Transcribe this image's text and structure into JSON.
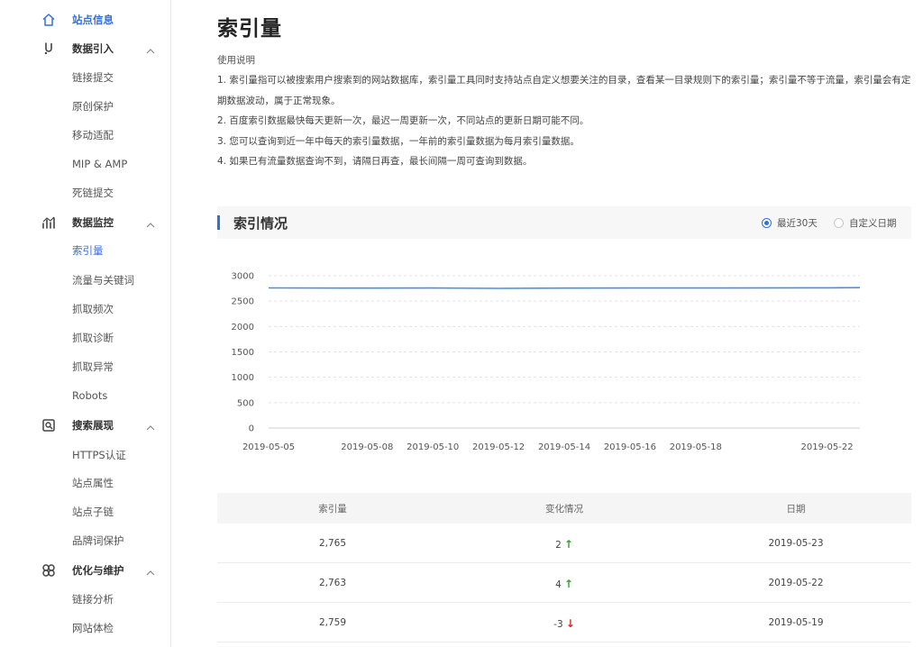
{
  "sidebar": {
    "items": [
      {
        "label": "站点信息",
        "type": "group",
        "icon": "home-icon",
        "active": true
      },
      {
        "label": "数据引入",
        "type": "group",
        "icon": "data-import-icon",
        "expanded": true
      },
      {
        "label": "链接提交",
        "type": "sub"
      },
      {
        "label": "原创保护",
        "type": "sub"
      },
      {
        "label": "移动适配",
        "type": "sub"
      },
      {
        "label": "MIP & AMP",
        "type": "sub"
      },
      {
        "label": "死链提交",
        "type": "sub"
      },
      {
        "label": "数据监控",
        "type": "group",
        "icon": "data-monitor-icon",
        "expanded": true
      },
      {
        "label": "索引量",
        "type": "sub",
        "active": true
      },
      {
        "label": "流量与关键词",
        "type": "sub"
      },
      {
        "label": "抓取频次",
        "type": "sub"
      },
      {
        "label": "抓取诊断",
        "type": "sub"
      },
      {
        "label": "抓取异常",
        "type": "sub"
      },
      {
        "label": "Robots",
        "type": "sub"
      },
      {
        "label": "搜索展现",
        "type": "group",
        "icon": "search-display-icon",
        "expanded": true
      },
      {
        "label": "HTTPS认证",
        "type": "sub"
      },
      {
        "label": "站点属性",
        "type": "sub"
      },
      {
        "label": "站点子链",
        "type": "sub"
      },
      {
        "label": "品牌词保护",
        "type": "sub"
      },
      {
        "label": "优化与维护",
        "type": "group",
        "icon": "optimize-icon",
        "expanded": true
      },
      {
        "label": "链接分析",
        "type": "sub"
      },
      {
        "label": "网站体检",
        "type": "sub"
      }
    ]
  },
  "main": {
    "title": "索引量",
    "usage_title": "使用说明",
    "usage_lines": [
      "1. 索引量指可以被搜索用户搜索到的网站数据库，索引量工具同时支持站点自定义想要关注的目录，查看某一目录规则下的索引量；索引量不等于流量，索引量会有定期数据波动，属于正常现象。",
      "2. 百度索引数据最快每天更新一次，最迟一周更新一次，不同站点的更新日期可能不同。",
      "3. 您可以查询到近一年中每天的索引量数据，一年前的索引量数据为每月索引量数据。",
      "4. 如果已有流量数据查询不到，请隔日再查，最长间隔一周可查询到数据。"
    ],
    "section_title": "索引情况",
    "radio_options": [
      {
        "label": "最近30天",
        "checked": true
      },
      {
        "label": "自定义日期",
        "checked": false
      }
    ]
  },
  "chart_data": {
    "type": "line",
    "title": "",
    "xlabel": "",
    "ylabel": "",
    "ylim": [
      0,
      3000
    ],
    "yticks": [
      "3000",
      "2500",
      "2000",
      "1500",
      "1000",
      "500",
      "0"
    ],
    "xticks": [
      "2019-05-05",
      "2019-05-08",
      "2019-05-10",
      "2019-05-12",
      "2019-05-14",
      "2019-05-16",
      "2019-05-18",
      "2019-05-22"
    ],
    "grid": true,
    "series": [
      {
        "color": "#4a8ee0",
        "points": [
          [
            "2019-05-05",
            2760
          ],
          [
            "2019-05-08",
            2757
          ],
          [
            "2019-05-10",
            2758
          ],
          [
            "2019-05-12",
            2752
          ],
          [
            "2019-05-14",
            2757
          ],
          [
            "2019-05-16",
            2759
          ],
          [
            "2019-05-18",
            2759
          ],
          [
            "2019-05-19",
            2759
          ],
          [
            "2019-05-22",
            2763
          ],
          [
            "2019-05-23",
            2765
          ]
        ]
      }
    ]
  },
  "table": {
    "headers": [
      "索引量",
      "变化情况",
      "日期"
    ],
    "rows": [
      {
        "count": "2,765",
        "change": "2",
        "direction": "up",
        "date": "2019-05-23"
      },
      {
        "count": "2,763",
        "change": "4",
        "direction": "up",
        "date": "2019-05-22"
      },
      {
        "count": "2,759",
        "change": "-3",
        "direction": "down",
        "date": "2019-05-19"
      }
    ]
  },
  "colors": {
    "accent": "#3370d6",
    "up": "#3a9b3a",
    "down": "#e02424",
    "line": "#4a8ee0"
  }
}
